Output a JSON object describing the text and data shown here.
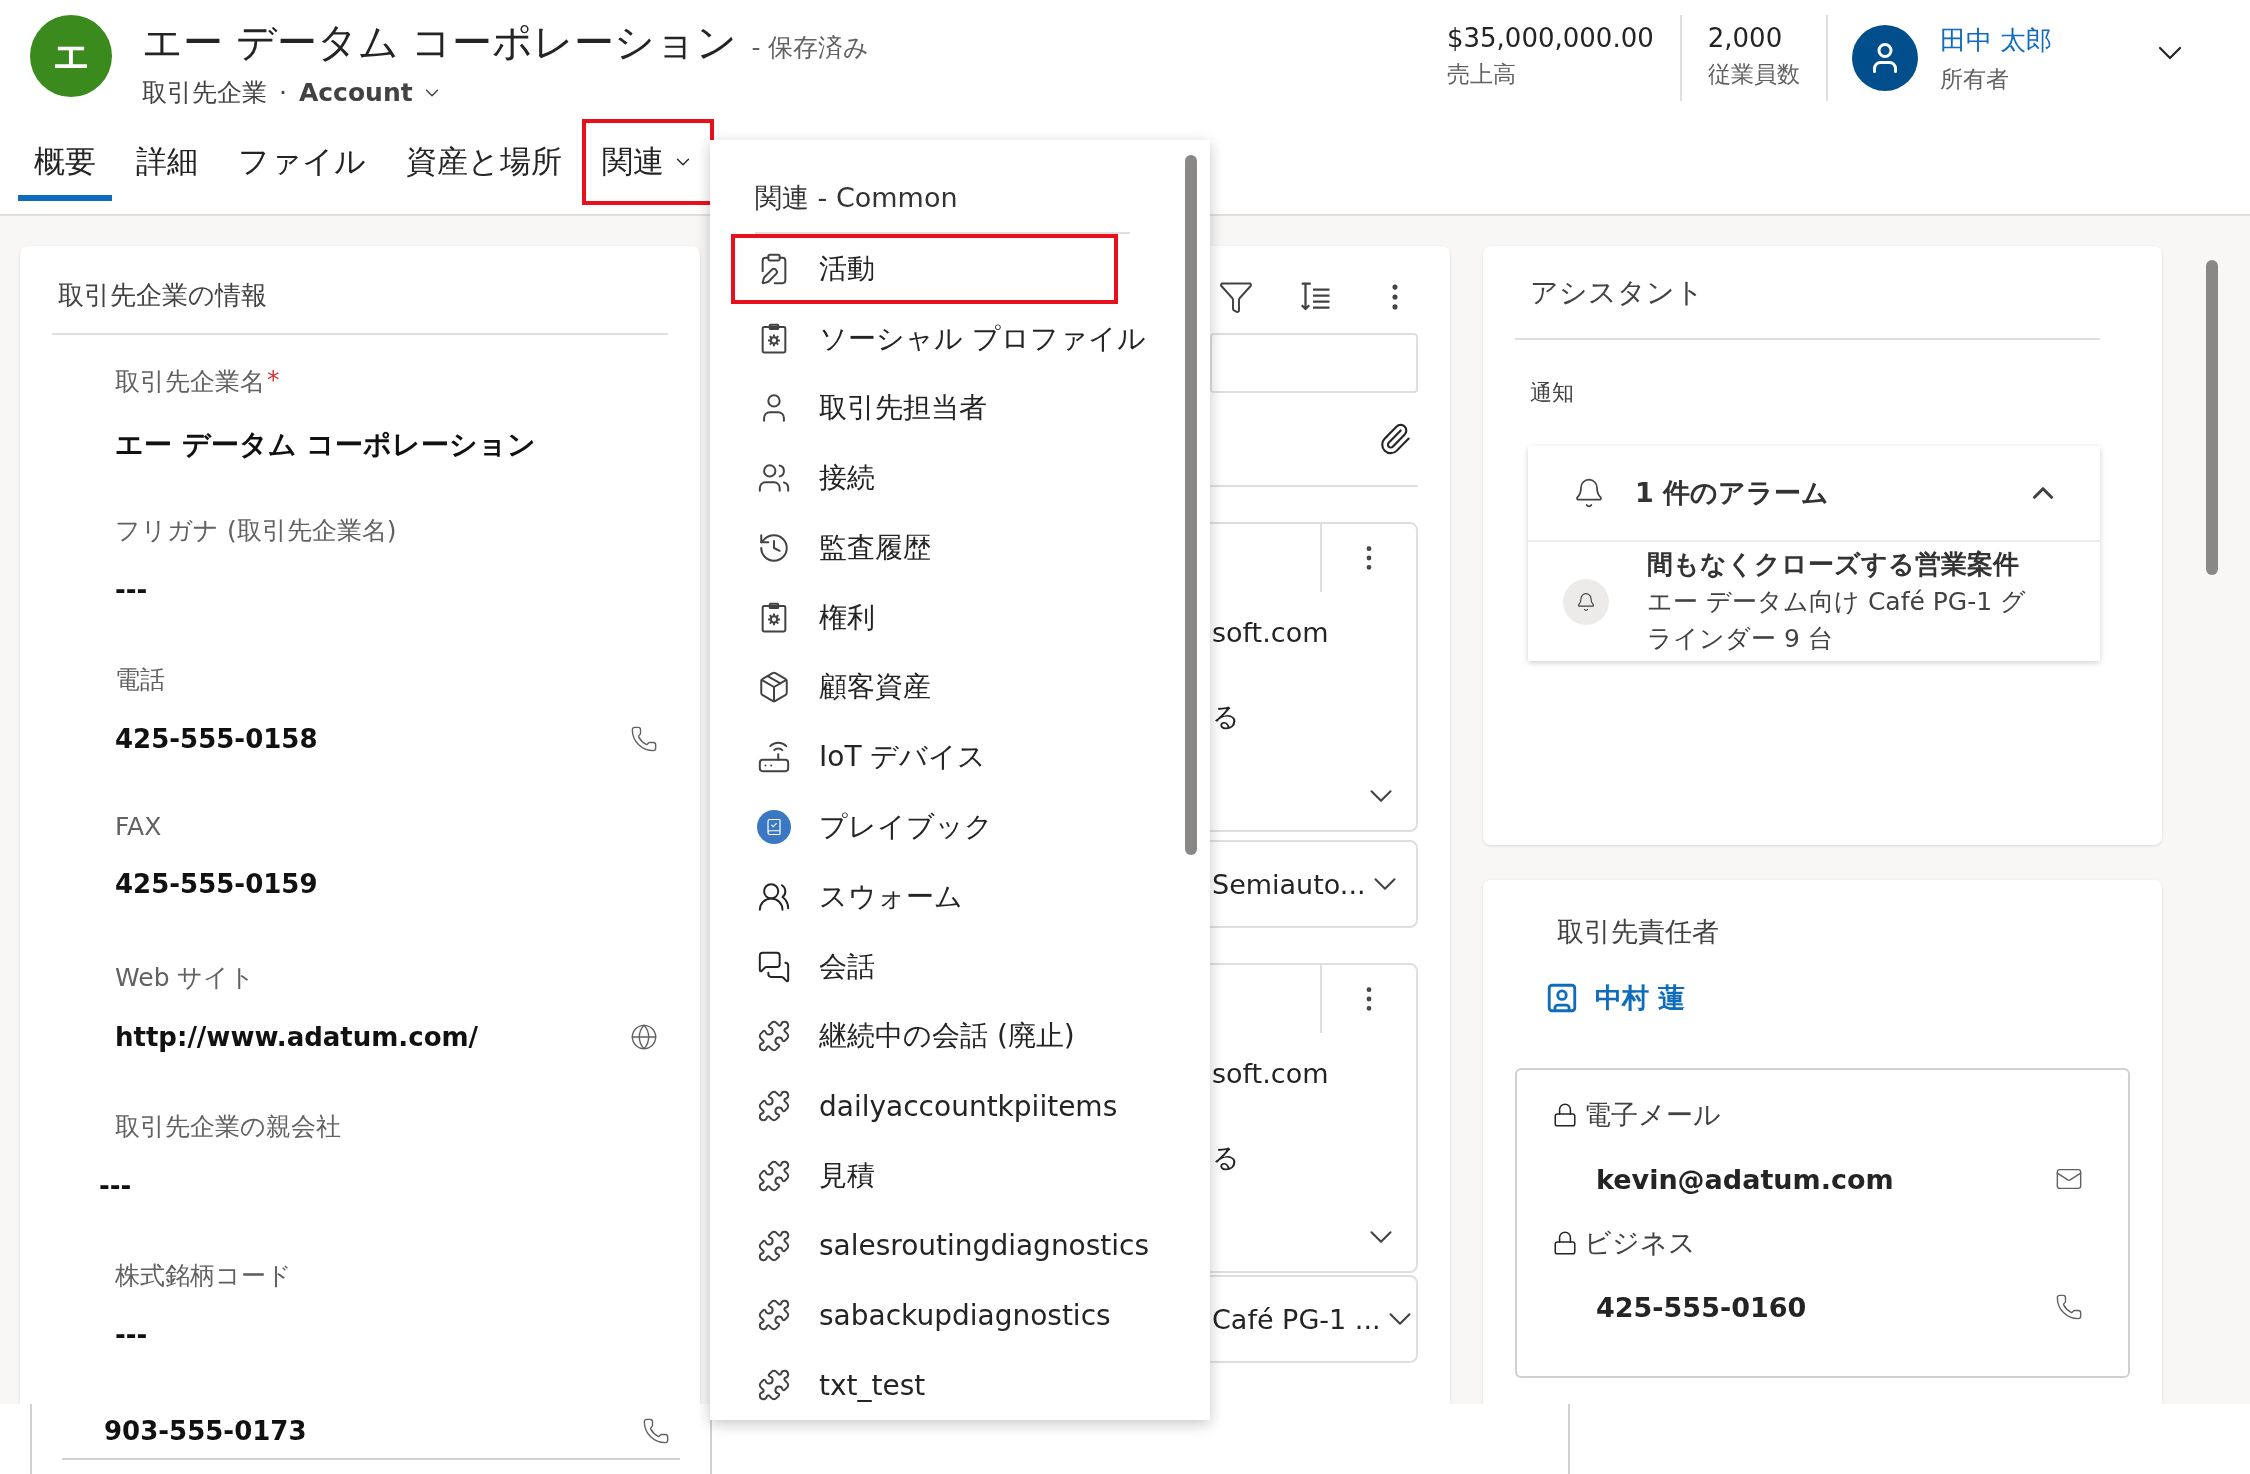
{
  "record": {
    "avatar": "エ",
    "title": "エー データム コーポレーション",
    "status": "- 保存済み",
    "entity": "取引先企業",
    "separator": "·",
    "form": "Account"
  },
  "header_fields": [
    {
      "value": "$35,000,000.00",
      "label": "売上高"
    },
    {
      "value": "2,000",
      "label": "従業員数"
    }
  ],
  "owner": {
    "name": "田中 太郎",
    "label": "所有者"
  },
  "tabs": [
    {
      "label": "概要",
      "selected": true,
      "highlighted": false,
      "dropdown": false
    },
    {
      "label": "詳細",
      "selected": false,
      "highlighted": false,
      "dropdown": false
    },
    {
      "label": "ファイル",
      "selected": false,
      "highlighted": false,
      "dropdown": false
    },
    {
      "label": "資産と場所",
      "selected": false,
      "highlighted": false,
      "dropdown": false
    },
    {
      "label": "関連",
      "selected": false,
      "highlighted": true,
      "dropdown": true
    }
  ],
  "account_info": {
    "title": "取引先企業の情報",
    "fields": [
      {
        "label": "取引先企業名",
        "required_mark": "*",
        "value": "エー データム コーポレーション",
        "kind": "title"
      },
      {
        "label": "フリガナ (取引先企業名)",
        "value": "---",
        "kind": "text"
      },
      {
        "label": "電話",
        "value": "425-555-0158",
        "kind": "phone"
      },
      {
        "label": "FAX",
        "value": "425-555-0159",
        "kind": "text"
      },
      {
        "label": "Web サイト",
        "value": "http://www.adatum.com/",
        "kind": "web"
      },
      {
        "label": "取引先企業の親会社",
        "value": "---",
        "kind": "lookup"
      },
      {
        "label": "株式銘柄コード",
        "value": "---",
        "kind": "text"
      }
    ]
  },
  "timeline": {
    "items": [
      {
        "kind": "post",
        "text": "soft.com",
        "text_2": "る"
      },
      {
        "kind": "field",
        "text": "Semiauto..."
      },
      {
        "kind": "post",
        "text": "soft.com",
        "text_2": "る"
      },
      {
        "kind": "field",
        "text": "Café PG-1 ..."
      }
    ]
  },
  "related_menu": {
    "heading": "関連 - Common",
    "items": [
      {
        "label": "活動",
        "highlighted": true
      },
      {
        "label": "ソーシャル プロファイル",
        "highlighted": false
      },
      {
        "label": "取引先担当者",
        "highlighted": false
      },
      {
        "label": "接続",
        "highlighted": false
      },
      {
        "label": "監査履歴",
        "highlighted": false
      },
      {
        "label": "権利",
        "highlighted": false
      },
      {
        "label": "顧客資産",
        "highlighted": false
      },
      {
        "label": "IoT デバイス",
        "highlighted": false
      },
      {
        "label": "プレイブック",
        "highlighted": false
      },
      {
        "label": "スウォーム",
        "highlighted": false
      },
      {
        "label": "会話",
        "highlighted": false
      },
      {
        "label": "継続中の会話 (廃止)",
        "highlighted": false
      },
      {
        "label": "dailyaccountkpiitems",
        "highlighted": false
      },
      {
        "label": "見積",
        "highlighted": false
      },
      {
        "label": "salesroutingdiagnostics",
        "highlighted": false
      },
      {
        "label": "sabackupdiagnostics",
        "highlighted": false
      },
      {
        "label": "txt_test",
        "highlighted": false
      }
    ]
  },
  "assistant": {
    "title": "アシスタント",
    "section": "通知",
    "alarm": {
      "title": "1 件のアラーム",
      "expanded": true,
      "item_title": "間もなくクローズする営業案件",
      "item_text": "エー データム向け Café PG-1 グラインダー 9 台"
    }
  },
  "primary_contact": {
    "title": "取引先責任者",
    "name": "中村 蓮",
    "rows": [
      {
        "label": "電子メール",
        "value": "kevin@adatum.com",
        "kind": "email"
      },
      {
        "label": "ビジネス",
        "value": "425-555-0160",
        "kind": "phone"
      }
    ]
  },
  "bottom_strip": {
    "value": "903-555-0173"
  }
}
